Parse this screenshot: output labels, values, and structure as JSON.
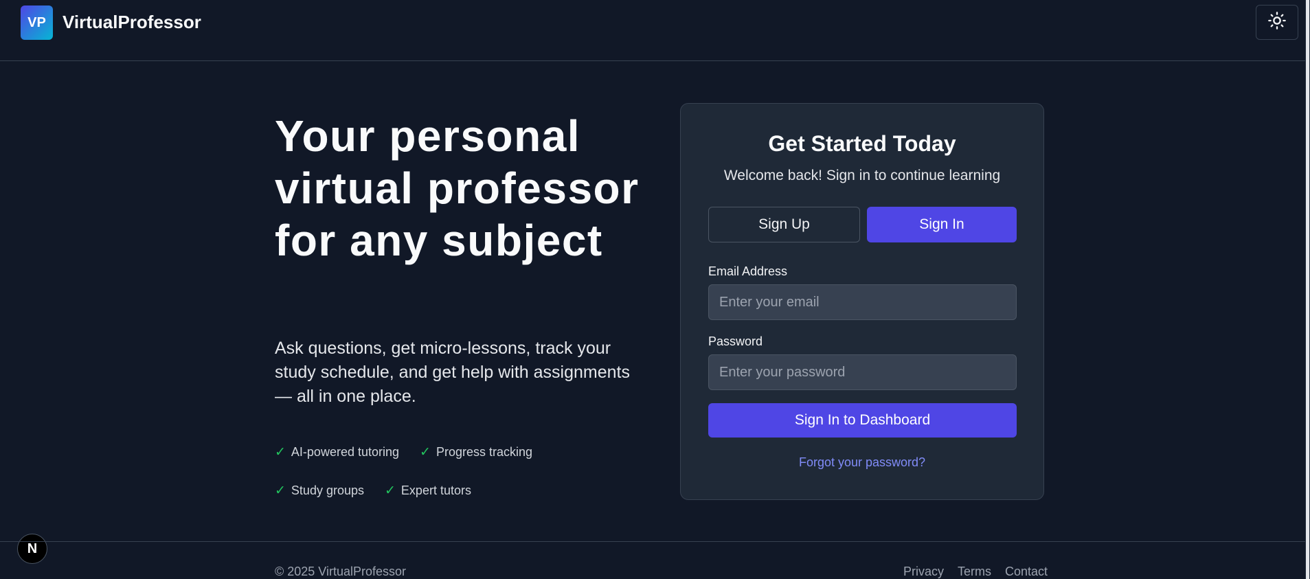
{
  "header": {
    "logo_initials": "VP",
    "brand_name": "VirtualProfessor",
    "theme_toggle_icon": "sun-icon"
  },
  "hero": {
    "heading": "Your personal virtual professor for any subject",
    "subheading": "Ask questions, get micro-lessons, track your study schedule, and get help with assignments — all in one place.",
    "features": [
      {
        "check": "✓",
        "label": "AI-powered tutoring"
      },
      {
        "check": "✓",
        "label": "Progress tracking"
      },
      {
        "check": "✓",
        "label": "Study groups"
      },
      {
        "check": "✓",
        "label": "Expert tutors"
      }
    ]
  },
  "auth_card": {
    "title": "Get Started Today",
    "subtitle": "Welcome back! Sign in to continue learning",
    "tabs": {
      "sign_up": "Sign Up",
      "sign_in": "Sign In",
      "active": "sign_in"
    },
    "email": {
      "label": "Email Address",
      "value": "",
      "placeholder": "Enter your email"
    },
    "password": {
      "label": "Password",
      "value": "",
      "placeholder": "Enter your password"
    },
    "submit_label": "Sign In to Dashboard",
    "forgot_label": "Forgot your password?"
  },
  "dev_badge": {
    "letter": "N"
  },
  "footer": {
    "copyright": "© 2025 VirtualProfessor",
    "links": [
      "Privacy",
      "Terms",
      "Contact"
    ]
  },
  "colors": {
    "background": "#111827",
    "card": "#1f2937",
    "accent": "#4f46e5",
    "link": "#818cf8",
    "check": "#22c55e"
  }
}
